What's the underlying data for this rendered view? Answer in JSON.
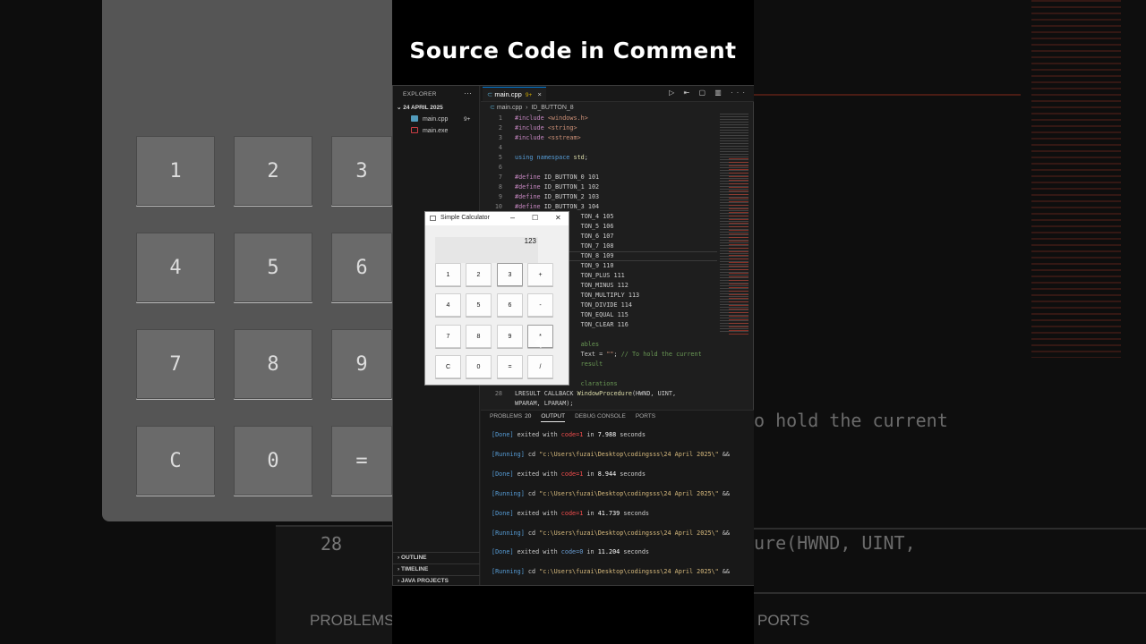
{
  "headline": "Source Code in Comment",
  "background": {
    "left_keys": [
      "1",
      "2",
      "3",
      "4",
      "5",
      "6",
      "7",
      "8",
      "9",
      "C",
      "0",
      "="
    ],
    "left_line_number": "28",
    "left_panel_label": "PROBLEMS",
    "right_text_1": "o hold the current",
    "right_text_2": "ure(HWND, UINT,",
    "right_panel_label": "PORTS"
  },
  "explorer": {
    "title": "EXPLORER",
    "more": "···",
    "folder": "24 APRIL 2025",
    "files": [
      {
        "name": "main.cpp",
        "badge": "9+",
        "icon_color": "#519aba"
      },
      {
        "name": "main.exe",
        "badge": "",
        "icon_color": "#cc3e44"
      }
    ],
    "sections": [
      "OUTLINE",
      "TIMELINE",
      "JAVA PROJECTS"
    ]
  },
  "editor": {
    "tab_label": "main.cpp",
    "tab_dirty": "9+",
    "tab_close": "×",
    "actions": "▷ ⇤ ▢ ▥ ···",
    "breadcrumb_file": "main.cpp",
    "breadcrumb_symbol": "ID_BUTTON_8",
    "lines": [
      {
        "n": "1",
        "parts": [
          [
            "pp",
            "#include "
          ],
          [
            "str",
            "<windows.h>"
          ]
        ]
      },
      {
        "n": "2",
        "parts": [
          [
            "pp",
            "#include "
          ],
          [
            "str",
            "<string>"
          ]
        ]
      },
      {
        "n": "3",
        "parts": [
          [
            "pp",
            "#include "
          ],
          [
            "str",
            "<sstream>"
          ]
        ]
      },
      {
        "n": "4",
        "parts": []
      },
      {
        "n": "5",
        "parts": [
          [
            "kw",
            "using namespace "
          ],
          [
            "id",
            "std"
          ],
          [
            "",
            "; "
          ]
        ]
      },
      {
        "n": "6",
        "parts": []
      },
      {
        "n": "7",
        "parts": [
          [
            "pp",
            "#define "
          ],
          [
            "",
            "ID_BUTTON_0 101"
          ]
        ]
      },
      {
        "n": "8",
        "parts": [
          [
            "pp",
            "#define "
          ],
          [
            "",
            "ID_BUTTON_1 102"
          ]
        ]
      },
      {
        "n": "9",
        "parts": [
          [
            "pp",
            "#define "
          ],
          [
            "",
            "ID_BUTTON_2 103"
          ]
        ]
      },
      {
        "n": "10",
        "parts": [
          [
            "pp",
            "#define "
          ],
          [
            "",
            "ID_BUTTON_3 104"
          ]
        ]
      },
      {
        "n": "",
        "parts": [
          [
            "",
            "                  TON_4 105"
          ]
        ]
      },
      {
        "n": "",
        "parts": [
          [
            "",
            "                  TON_5 106"
          ]
        ]
      },
      {
        "n": "",
        "parts": [
          [
            "",
            "                  TON_6 107"
          ]
        ]
      },
      {
        "n": "",
        "parts": [
          [
            "",
            "                  TON_7 108"
          ]
        ]
      },
      {
        "n": "",
        "parts": [
          [
            "",
            "                  TON_8 109"
          ]
        ]
      },
      {
        "n": "",
        "parts": [
          [
            "",
            "                  TON_9 110"
          ]
        ]
      },
      {
        "n": "",
        "parts": [
          [
            "",
            "                  TON_PLUS 111"
          ]
        ]
      },
      {
        "n": "",
        "parts": [
          [
            "",
            "                  TON_MINUS 112"
          ]
        ]
      },
      {
        "n": "",
        "parts": [
          [
            "",
            "                  TON_MULTIPLY 113"
          ]
        ]
      },
      {
        "n": "",
        "parts": [
          [
            "",
            "                  TON_DIVIDE 114"
          ]
        ]
      },
      {
        "n": "",
        "parts": [
          [
            "",
            "                  TON_EQUAL 115"
          ]
        ]
      },
      {
        "n": "",
        "parts": [
          [
            "",
            "                  TON_CLEAR 116"
          ]
        ]
      },
      {
        "n": "",
        "parts": []
      },
      {
        "n": "",
        "parts": [
          [
            "cm",
            "                  ables"
          ]
        ]
      },
      {
        "n": "",
        "parts": [
          [
            "",
            "                  Text = "
          ],
          [
            "str",
            "\"\""
          ],
          [
            "",
            "; "
          ],
          [
            "cm",
            "// To hold the current"
          ]
        ]
      },
      {
        "n": "",
        "parts": [
          [
            "cm",
            "                  result"
          ]
        ]
      },
      {
        "n": "",
        "parts": []
      },
      {
        "n": "",
        "parts": [
          [
            "cm",
            "                  clarations"
          ]
        ]
      },
      {
        "n": "28",
        "parts": [
          [
            "",
            "LRESULT CALLBACK "
          ],
          [
            "id",
            "WindowProcedure"
          ],
          [
            "",
            "(HWND, UINT,"
          ]
        ]
      },
      {
        "n": "",
        "parts": [
          [
            "",
            "WPARAM, LPARAM);"
          ]
        ]
      }
    ]
  },
  "panel": {
    "tabs": [
      {
        "label": "PROBLEMS",
        "count": "20"
      },
      {
        "label": "OUTPUT",
        "count": ""
      },
      {
        "label": "DEBUG CONSOLE",
        "count": ""
      },
      {
        "label": "PORTS",
        "count": ""
      }
    ],
    "output": [
      {
        "kind": "done",
        "tag": "[Done]",
        "text": " exited with ",
        "code": "code=1",
        "rest": " in ",
        "secs": "7.988",
        "tail": " seconds"
      },
      {
        "kind": "run",
        "tag": "[Running]",
        "text": " cd ",
        "path": "\"c:\\Users\\fuzai\\Desktop\\codingsss\\24 April 2025\\\"",
        "tail": " &&"
      },
      {
        "kind": "done",
        "tag": "[Done]",
        "text": " exited with ",
        "code": "code=1",
        "rest": " in ",
        "secs": "8.944",
        "tail": " seconds"
      },
      {
        "kind": "run",
        "tag": "[Running]",
        "text": " cd ",
        "path": "\"c:\\Users\\fuzai\\Desktop\\codingsss\\24 April 2025\\\"",
        "tail": " &&"
      },
      {
        "kind": "done",
        "tag": "[Done]",
        "text": " exited with ",
        "code": "code=1",
        "rest": " in ",
        "secs": "41.739",
        "tail": " seconds"
      },
      {
        "kind": "run",
        "tag": "[Running]",
        "text": " cd ",
        "path": "\"c:\\Users\\fuzai\\Desktop\\codingsss\\24 April 2025\\\"",
        "tail": " &&"
      },
      {
        "kind": "done-ok",
        "tag": "[Done]",
        "text": " exited with ",
        "code": "code=0",
        "rest": " in ",
        "secs": "11.204",
        "tail": " seconds"
      },
      {
        "kind": "run",
        "tag": "[Running]",
        "text": " cd ",
        "path": "\"c:\\Users\\fuzai\\Desktop\\codingsss\\24 April 2025\\\"",
        "tail": " &&"
      }
    ]
  },
  "calculator": {
    "title": "Simple Calculator",
    "minimize": "–",
    "maximize": "☐",
    "close": "✕",
    "display": "123",
    "keys": [
      [
        "1",
        "2",
        "3",
        "+"
      ],
      [
        "4",
        "5",
        "6",
        "-"
      ],
      [
        "7",
        "8",
        "9",
        "*"
      ],
      [
        "C",
        "0",
        "=",
        "/"
      ]
    ]
  }
}
